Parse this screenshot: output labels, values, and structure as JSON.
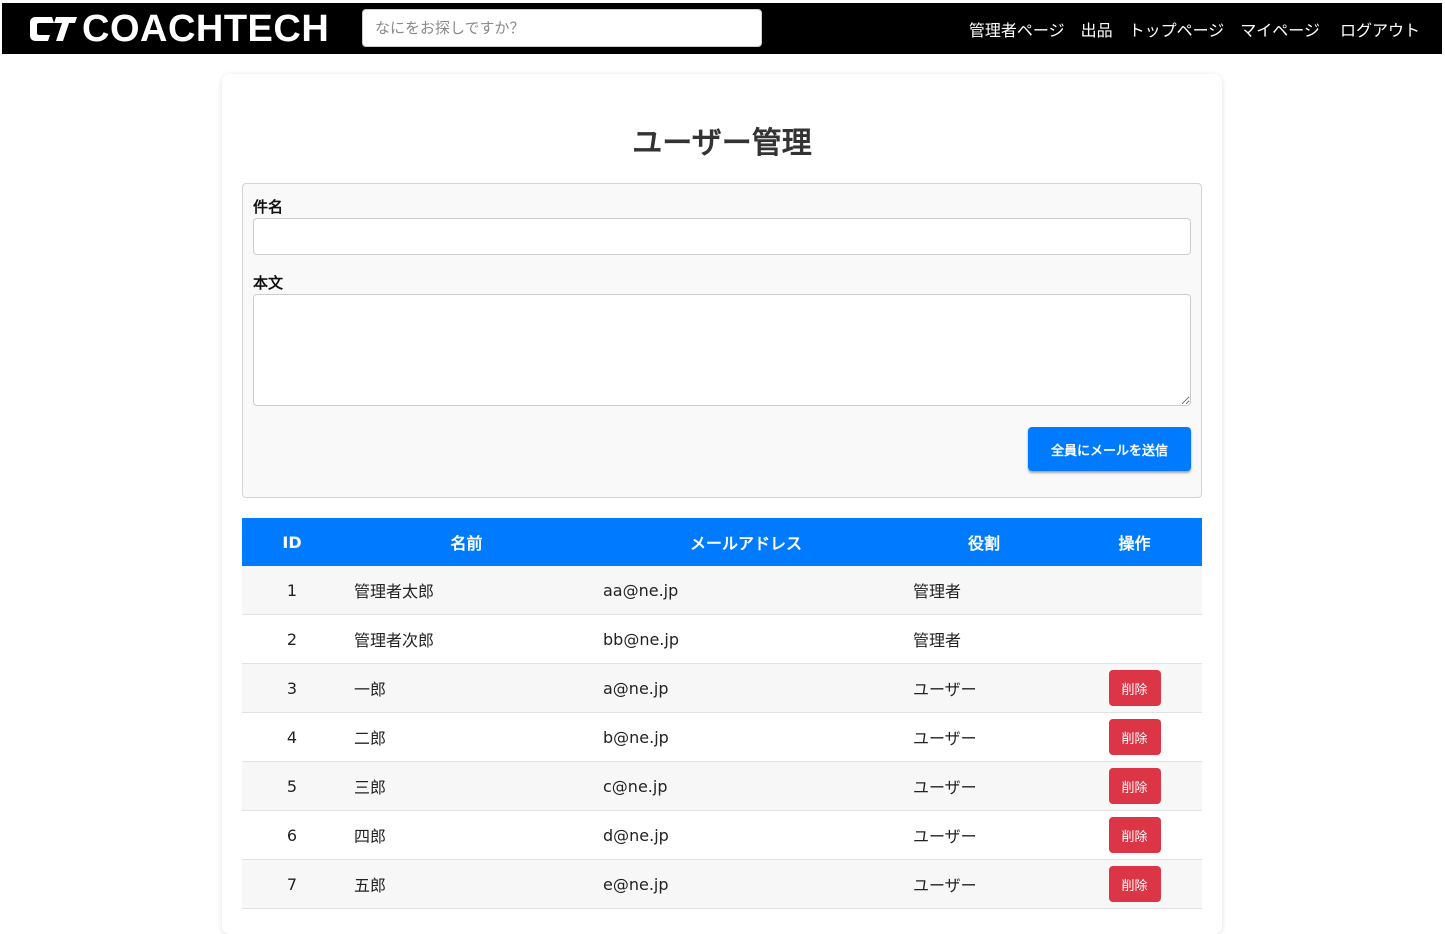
{
  "header": {
    "logo_text": "COACHTECH",
    "search_placeholder": "なにをお探しですか？",
    "nav": {
      "admin": "管理者ページ",
      "sell": "出品",
      "top": "トップページ",
      "mypage": "マイページ",
      "logout": "ログアウト"
    }
  },
  "page": {
    "title": "ユーザー管理"
  },
  "mail_form": {
    "subject_label": "件名",
    "subject_value": "",
    "body_label": "本文",
    "body_value": "",
    "send_label": "全員にメールを送信"
  },
  "table": {
    "headers": {
      "id": "ID",
      "name": "名前",
      "email": "メールアドレス",
      "role": "役割",
      "ops": "操作"
    },
    "delete_label": "削除",
    "rows": [
      {
        "id": "1",
        "name": "管理者太郎",
        "email": "aa@ne.jp",
        "role": "管理者",
        "deletable": false
      },
      {
        "id": "2",
        "name": "管理者次郎",
        "email": "bb@ne.jp",
        "role": "管理者",
        "deletable": false
      },
      {
        "id": "3",
        "name": "一郎",
        "email": "a@ne.jp",
        "role": "ユーザー",
        "deletable": true
      },
      {
        "id": "4",
        "name": "二郎",
        "email": "b@ne.jp",
        "role": "ユーザー",
        "deletable": true
      },
      {
        "id": "5",
        "name": "三郎",
        "email": "c@ne.jp",
        "role": "ユーザー",
        "deletable": true
      },
      {
        "id": "6",
        "name": "四郎",
        "email": "d@ne.jp",
        "role": "ユーザー",
        "deletable": true
      },
      {
        "id": "7",
        "name": "五郎",
        "email": "e@ne.jp",
        "role": "ユーザー",
        "deletable": true
      }
    ]
  },
  "colors": {
    "header_bg": "#000000",
    "primary": "#007bff",
    "danger": "#dc3545"
  }
}
